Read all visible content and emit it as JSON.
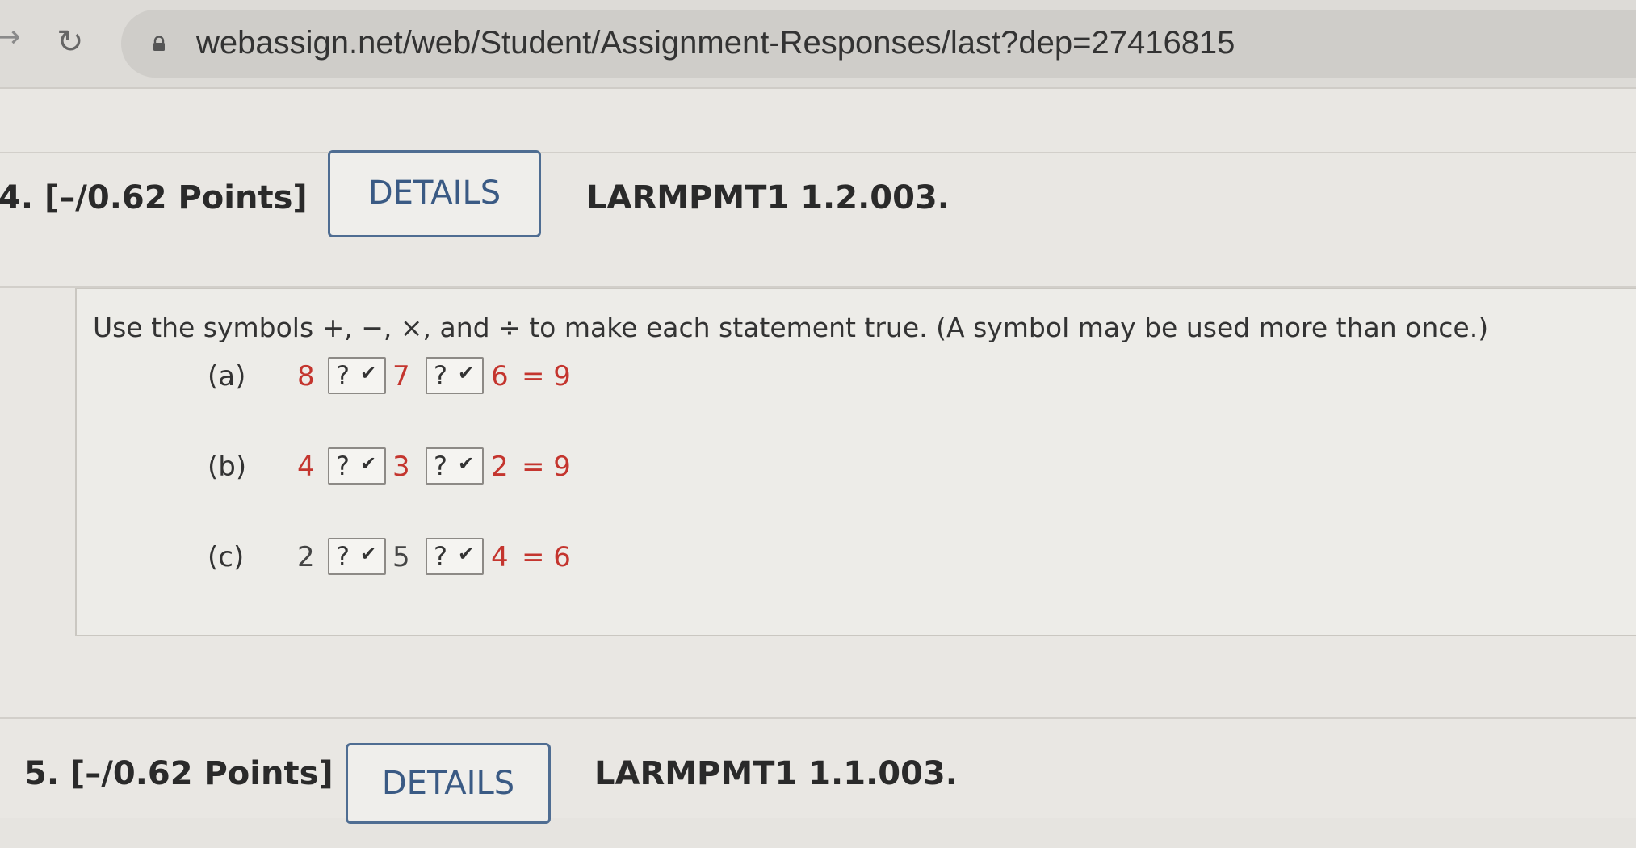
{
  "browser": {
    "url": "webassign.net/web/Student/Assignment-Responses/last?dep=27416815",
    "forward_icon": "arrow-right",
    "reload_icon": "reload",
    "lock_icon": "lock"
  },
  "questions": [
    {
      "number": "4.",
      "points": "[–/0.62 Points]",
      "details_label": "DETAILS",
      "code": "LARMPMT1 1.2.003.",
      "prompt": "Use the symbols +, −, ×, and ÷ to make each statement true. (A symbol may be used more than once.)",
      "parts": [
        {
          "label": "(a)",
          "a": "8",
          "b": "7",
          "c": "6",
          "result": "= 9",
          "select1": "?",
          "select2": "?"
        },
        {
          "label": "(b)",
          "a": "4",
          "b": "3",
          "c": "2",
          "result": "= 9",
          "select1": "?",
          "select2": "?"
        },
        {
          "label": "(c)",
          "a": "2",
          "b": "5",
          "c": "4",
          "result": "= 6",
          "select1": "?",
          "select2": "?"
        }
      ]
    },
    {
      "number": "5.",
      "points": "[–/0.62 Points]",
      "details_label": "DETAILS",
      "code": "LARMPMT1 1.1.003."
    }
  ],
  "colors": {
    "accent_button": "#3a5a84",
    "answer_red": "#c4352e"
  }
}
